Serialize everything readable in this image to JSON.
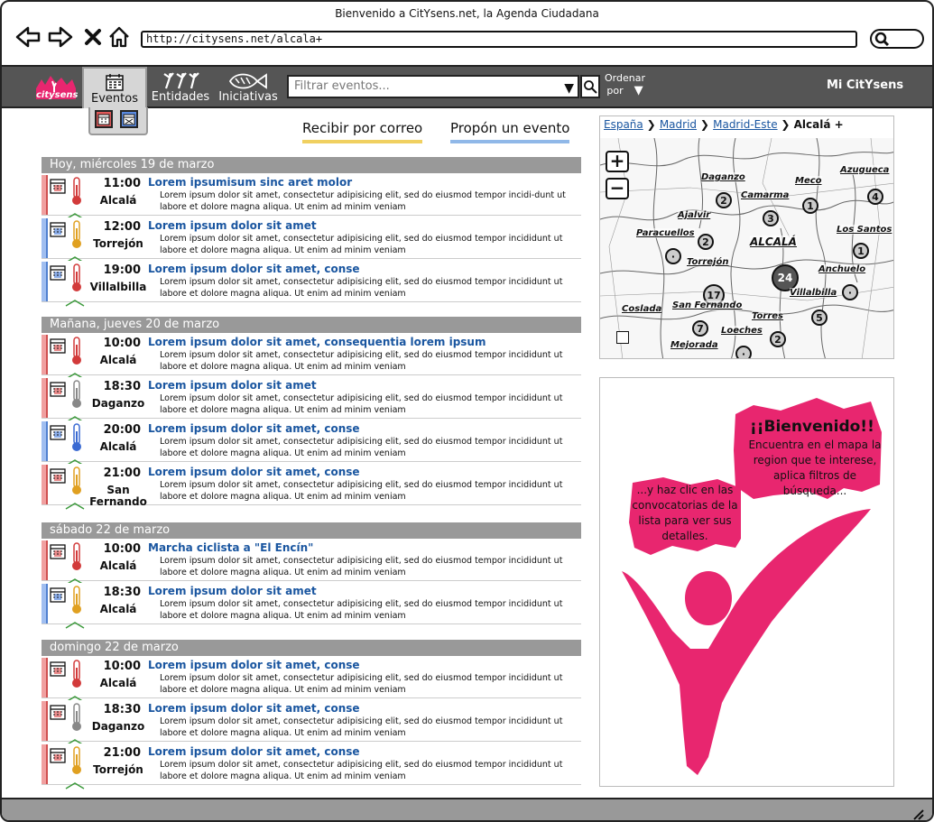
{
  "browser": {
    "title": "Bienvenido a CitYsens.net, la Agenda Ciudadana",
    "url": "http://citysens.net/alcala+"
  },
  "logo_text": "citysens",
  "nav": {
    "eventos": "Eventos",
    "entidades": "Entidades",
    "iniciativas": "Iniciativas",
    "mi": "Mi CitYsens"
  },
  "filter": {
    "placeholder": "Filtrar eventos..."
  },
  "ordenar": {
    "line1": "Ordenar",
    "line2": "por"
  },
  "links": {
    "recibir": "Recibir por correo",
    "propon": "Propón un evento"
  },
  "colors": {
    "accent_pink": "#e8266f",
    "link_blue": "#1a56a0",
    "red": "#e05a5a",
    "blue": "#5a8ae0",
    "yellow": "#f0c030",
    "green": "#3c9a3c"
  },
  "days": [
    {
      "label": "Hoy, miércoles 19 de marzo",
      "events": [
        {
          "time": "11:00",
          "city": "Alcalá",
          "title": "Lorem ipsumisum sinc aret molor",
          "desc": "Lorem ipsum dolor sit amet, consectetur adipisicing elit, sed do eiusmod tempor incidi-dunt ut labore et dolore magna aliqua. Ut enim ad minim veniam",
          "strip": "red",
          "temp": "red",
          "cal": "red"
        },
        {
          "time": "12:00",
          "city": "Torrejón",
          "title": "Lorem ipsum dolor sit amet",
          "desc": "Lorem ipsum dolor sit amet, consectetur adipisicing elit, sed do eiusmod tempor incididunt ut labore et dolore magna aliqua. Ut enim ad minim veniam",
          "strip": "blue",
          "temp": "yellow",
          "cal": "blue"
        },
        {
          "time": "19:00",
          "city": "Villalbilla",
          "title": "Lorem ipsum dolor sit amet, conse",
          "desc": "Lorem ipsum dolor sit amet, consectetur adipisicing elit, sed do eiusmod tempor incididunt ut labore et dolore magna aliqua. Ut enim ad minim veniam",
          "strip": "blue",
          "temp": "red",
          "cal": "blue"
        }
      ]
    },
    {
      "label": "Mañana, jueves 20 de marzo",
      "events": [
        {
          "time": "10:00",
          "city": "Alcalá",
          "title": "Lorem ipsum dolor sit amet, consequentia lorem ipsum",
          "desc": "Lorem ipsum dolor sit amet, consectetur adipisicing elit, sed do eiusmod tempor incididunt ut labore et dolore magna aliqua. Ut enim ad minim veniam",
          "strip": "red",
          "temp": "red",
          "cal": "red"
        },
        {
          "time": "18:30",
          "city": "Daganzo",
          "title": "Lorem ipsum dolor sit amet",
          "desc": "Lorem ipsum dolor sit amet, consectetur adipisicing elit, sed do eiusmod tempor incididunt ut labore et dolore magna aliqua. Ut enim ad minim veniam",
          "strip": "red",
          "temp": "gray",
          "cal": "red"
        },
        {
          "time": "20:00",
          "city": "Alcalá",
          "title": "Lorem ipsum dolor sit amet, conse",
          "desc": "Lorem ipsum dolor sit amet, consectetur adipisicing elit, sed do eiusmod tempor incididunt ut labore et dolore magna aliqua. Ut enim ad minim veniam",
          "strip": "blue",
          "temp": "blue",
          "cal": "blue"
        },
        {
          "time": "21:00",
          "city": "San Fernando",
          "title": "Lorem ipsum dolor sit amet, conse",
          "desc": "Lorem ipsum dolor sit amet, consectetur adipisicing elit, sed do eiusmod tempor incididunt ut labore et dolore magna aliqua. Ut enim ad minim veniam",
          "strip": "red",
          "temp": "yellow",
          "cal": "red"
        }
      ]
    },
    {
      "label": "sábado 22 de marzo",
      "events": [
        {
          "time": "10:00",
          "city": "Alcalá",
          "title": "Marcha ciclista a \"El Encín\"",
          "desc": "Lorem ipsum dolor sit amet, consectetur adipisicing elit, sed do eiusmod tempor incididunt ut labore et dolore magna aliqua. Ut enim ad minim veniam",
          "strip": "red",
          "temp": "red",
          "cal": "red"
        },
        {
          "time": "18:30",
          "city": "Alcalá",
          "title": "Lorem ipsum dolor sit amet",
          "desc": "Lorem ipsum dolor sit amet, consectetur adipisicing elit, sed do eiusmod tempor incididunt ut labore et dolore magna aliqua. Ut enim ad minim veniam",
          "strip": "blue",
          "temp": "yellow",
          "cal": "blue"
        }
      ]
    },
    {
      "label": "domingo 22 de marzo",
      "events": [
        {
          "time": "10:00",
          "city": "Alcalá",
          "title": "Lorem ipsum dolor sit amet, conse",
          "desc": "Lorem ipsum dolor sit amet, consectetur adipisicing elit, sed do eiusmod tempor incididunt ut labore et dolore magna aliqua. Ut enim ad minim veniam",
          "strip": "red",
          "temp": "red",
          "cal": "red"
        },
        {
          "time": "18:30",
          "city": "Daganzo",
          "title": "Lorem ipsum dolor sit amet, conse",
          "desc": "Lorem ipsum dolor sit amet, consectetur adipisicing elit, sed do eiusmod tempor incididunt ut labore et dolore magna aliqua. Ut enim ad minim veniam",
          "strip": "red",
          "temp": "gray",
          "cal": "red"
        },
        {
          "time": "21:00",
          "city": "Torrejón",
          "title": "Lorem ipsum dolor sit amet, conse",
          "desc": "Lorem ipsum dolor sit amet, consectetur adipisicing elit, sed do eiusmod tempor incididunt ut labore et dolore magna aliqua. Ut enim ad minim veniam",
          "strip": "red",
          "temp": "yellow",
          "cal": "red"
        }
      ]
    }
  ],
  "map": {
    "breadcrumb": [
      "España",
      "Madrid",
      "Madrid-Este"
    ],
    "current": "Alcalá +",
    "zoom_in": "+",
    "zoom_out": "−",
    "places": [
      {
        "name": "Daganzo",
        "count": "2"
      },
      {
        "name": "Meco",
        "count": "1"
      },
      {
        "name": "Azugueca",
        "count": "4"
      },
      {
        "name": "Camarma",
        "count": "3"
      },
      {
        "name": "Ajalvir",
        "count": "2"
      },
      {
        "name": "Paracuellos",
        "count": "·"
      },
      {
        "name": "Los Santos",
        "count": "1"
      },
      {
        "name": "ALCALÁ",
        "count": "24"
      },
      {
        "name": "Torrejón",
        "count": "17"
      },
      {
        "name": "Anchuelo",
        "count": "·"
      },
      {
        "name": "Villalbilla",
        "count": "5"
      },
      {
        "name": "San Fernando",
        "count": "7"
      },
      {
        "name": "Coslada",
        "count": ""
      },
      {
        "name": "Torres",
        "count": "2"
      },
      {
        "name": "Loeches",
        "count": "·"
      },
      {
        "name": "Mejorada",
        "count": ""
      }
    ]
  },
  "welcome": {
    "title": "¡¡Bienvenido!!",
    "body": "Encuentra en el mapa la region que te interese, aplica filtros de búsqueda...",
    "bubble2": "...y haz clic en las convocatorias de la lista para ver sus detalles."
  }
}
